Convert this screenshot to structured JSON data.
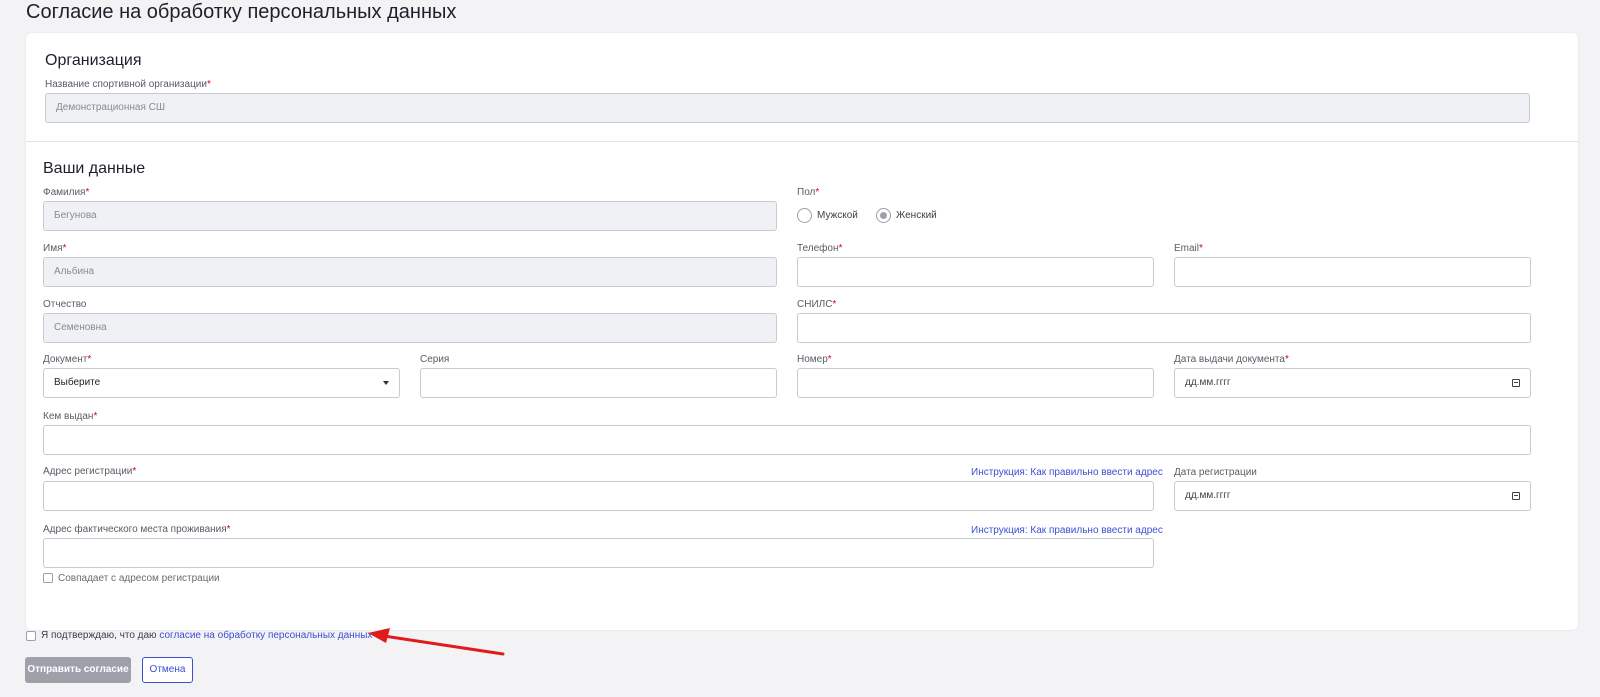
{
  "page": {
    "title": "Согласие на обработку персональных данных"
  },
  "organization": {
    "section_title": "Организация",
    "name_label": "Название спортивной организации",
    "name_value": "Демонстрационная СШ"
  },
  "personal": {
    "section_title": "Ваши данные",
    "last_name": {
      "label": "Фамилия",
      "value": "Бегунова"
    },
    "first_name": {
      "label": "Имя",
      "value": "Альбина"
    },
    "patronymic": {
      "label": "Отчество",
      "value": "Семеновна"
    },
    "gender": {
      "label": "Пол",
      "options": [
        "Мужской",
        "Женский"
      ],
      "selected": "Женский"
    },
    "phone": {
      "label": "Телефон",
      "value": ""
    },
    "email": {
      "label": "Email",
      "value": ""
    },
    "snils": {
      "label": "СНИЛС",
      "value": ""
    },
    "document": {
      "label": "Документ",
      "value": "Выберите"
    },
    "series": {
      "label": "Серия",
      "value": ""
    },
    "number": {
      "label": "Номер",
      "value": ""
    },
    "issue_date": {
      "label": "Дата выдачи документа",
      "placeholder": "дд.мм.гггг"
    },
    "issued_by": {
      "label": "Кем выдан",
      "value": ""
    },
    "reg_address": {
      "label": "Адрес регистрации",
      "value": ""
    },
    "reg_date": {
      "label": "Дата регистрации",
      "placeholder": "дд.мм.гггг"
    },
    "actual_address": {
      "label": "Адрес фактического места проживания",
      "value": ""
    },
    "address_help_link": "Инструкция: Как правильно ввести адрес",
    "same_address_label": "Совпадает с адресом регистрации"
  },
  "consent": {
    "text": "Я подтверждаю, что даю ",
    "link": "согласие на обработку персональных данных"
  },
  "actions": {
    "submit": "Отправить согласие",
    "cancel": "Отмена"
  },
  "colors": {
    "accent": "#3c4fd4",
    "required": "#d0021b",
    "arrow": "#e01b1b"
  }
}
